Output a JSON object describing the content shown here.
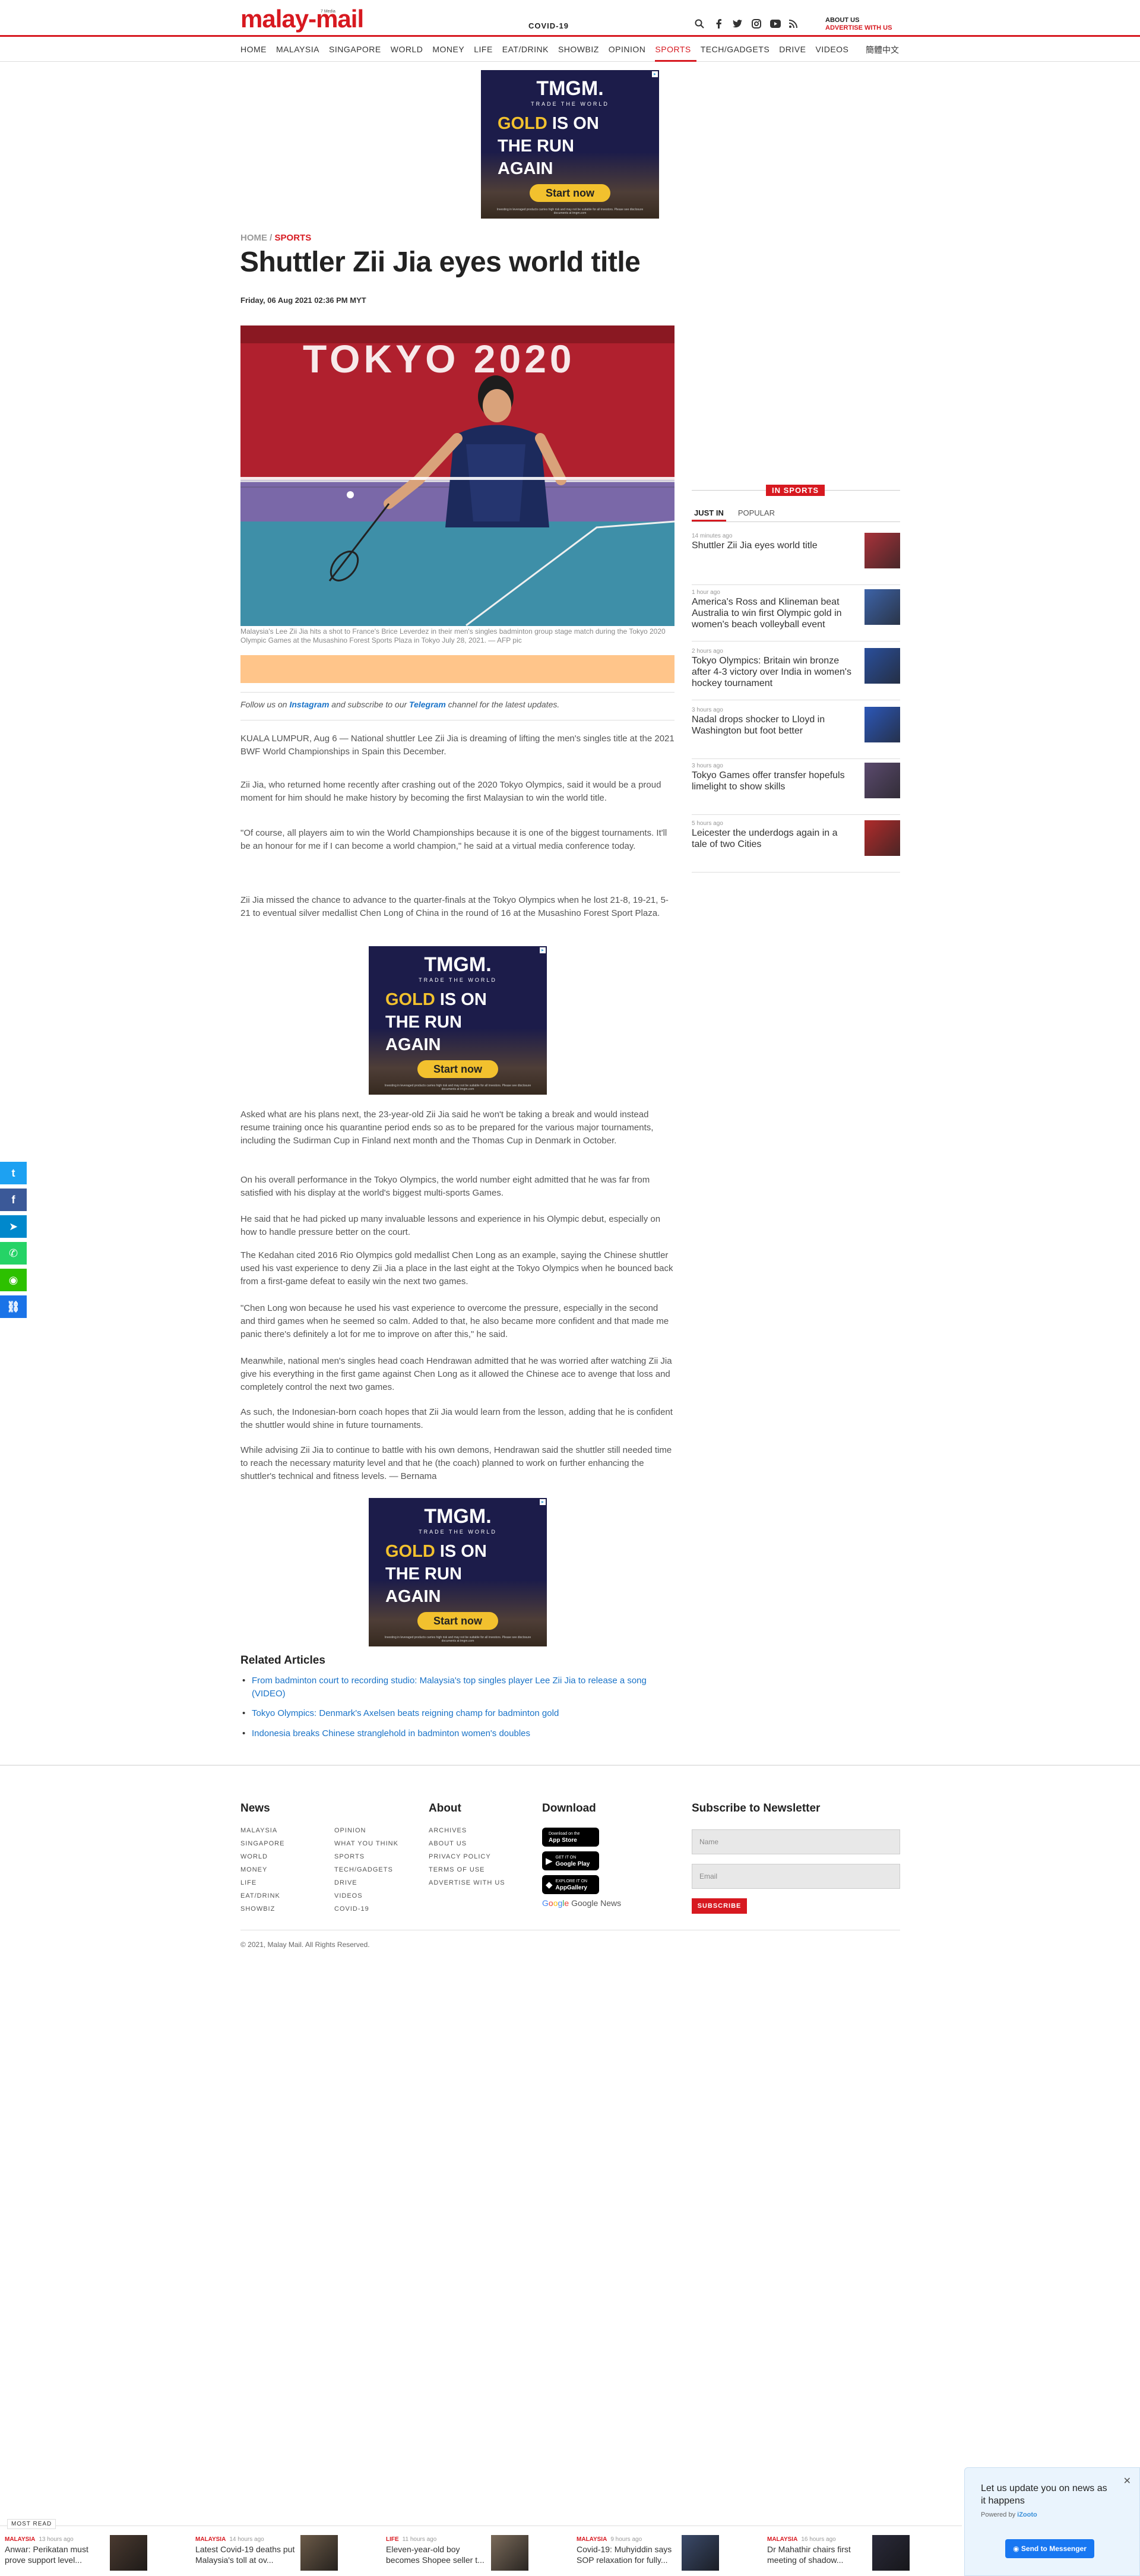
{
  "header": {
    "logo": "malay-mail",
    "logo_small": "7 Media",
    "covid": "COVID-19",
    "about": "ABOUT US",
    "advertise": "ADVERTISE WITH US",
    "icons": [
      "search-icon",
      "facebook-icon",
      "twitter-icon",
      "instagram-icon",
      "youtube-icon",
      "rss-icon"
    ]
  },
  "nav": {
    "items": [
      "HOME",
      "MALAYSIA",
      "SINGAPORE",
      "WORLD",
      "MONEY",
      "LIFE",
      "EAT/DRINK",
      "SHOWBIZ",
      "OPINION",
      "SPORTS",
      "TECH/GADGETS",
      "DRIVE",
      "VIDEOS"
    ],
    "active": "SPORTS",
    "chinese": "簡體中文"
  },
  "ad": {
    "brand": "TMGM.",
    "tagline": "TRADE THE WORLD",
    "line1_gold": "GOLD",
    "line1_rest": "IS ON",
    "line2": "THE RUN",
    "line3": "AGAIN",
    "cta": "Start now",
    "fine": "Investing in leveraged products carries high risk and may not be suitable for all investors. Please see disclosure documents at tmgm.com"
  },
  "article": {
    "breadcrumb_home": "HOME",
    "breadcrumb_sep": "/",
    "breadcrumb_section": "SPORTS",
    "title": "Shuttler Zii Jia eyes world title",
    "date": "Friday, 06 Aug 2021 02:36 PM MYT",
    "hero_text": "TOKYO 2020",
    "caption": "Malaysia's Lee Zii Jia hits a shot to France's Brice Leverdez in their men's singles badminton group stage match during the Tokyo 2020 Olympic Games at the Musashino Forest Sports Plaza in Tokyo July 28, 2021. — AFP pic",
    "follow_pre": "Follow us on ",
    "follow_instagram": "Instagram",
    "follow_mid": " and subscribe to our ",
    "follow_telegram": "Telegram",
    "follow_post": " channel for the latest updates.",
    "paragraphs": [
      "KUALA LUMPUR, Aug 6 — National shuttler Lee Zii Jia is dreaming of lifting the men's singles title at the 2021 BWF World Championships in Spain this December.",
      "Zii Jia, who returned home recently after crashing out of the 2020 Tokyo Olympics, said it would be a proud moment for him should he make history by becoming the first Malaysian to win the world title.",
      "\"Of course, all players aim to win the World Championships because it is one of the biggest tournaments. It'll be an honour for me if I can become a world champion,\" he said at a virtual media conference today.",
      "Zii Jia missed the chance to advance to the quarter-finals at the Tokyo Olympics when he lost 21-8, 19-21, 5-21 to eventual silver medallist Chen Long of China in the round of 16 at the Musashino Forest Sport Plaza.",
      "Asked what are his plans next, the 23-year-old Zii Jia said he won't be taking a break and would instead resume training once his quarantine period ends so as to be prepared for the various major tournaments, including the Sudirman Cup in Finland next month and the Thomas Cup in Denmark in October.",
      "On his overall performance in the Tokyo Olympics, the world number eight admitted that he was far from satisfied with his display at the world's biggest multi-sports Games.",
      "He said that he had picked up many invaluable lessons and experience in his Olympic debut, especially on how to handle pressure better on the court.",
      "The Kedahan cited 2016 Rio Olympics gold medallist Chen Long as an example, saying the Chinese shuttler used his vast experience to deny Zii Jia a place in the last eight at the Tokyo Olympics when he bounced back from a first-game defeat to easily win the next two games.",
      "\"Chen Long won because he used his vast experience to overcome the pressure, especially in the second and third games when he seemed so calm. Added to that, he also became more confident and that made me panic there's definitely a lot for me to improve on after this,\" he said.",
      "Meanwhile, national men's singles head coach Hendrawan admitted that he was worried after watching Zii Jia give his everything in the first game against Chen Long as it allowed the Chinese ace to avenge that loss and completely control the next two games.",
      "As such, the Indonesian-born coach hopes that Zii Jia would learn from the lesson, adding that he is confident the shuttler would shine in future tournaments.",
      "While advising Zii Jia to continue to battle with his own demons, Hendrawan said the shuttler still needed time to reach the necessary maturity level and that he (the coach) planned to work on further enhancing the shuttler's technical and fitness levels. — Bernama"
    ]
  },
  "sidebar": {
    "label": "IN SPORTS",
    "tabs": [
      "JUST IN",
      "POPULAR"
    ],
    "items": [
      {
        "time": "14 minutes ago",
        "title": "Shuttler Zii Jia eyes world title",
        "color": "#a8323a"
      },
      {
        "time": "1 hour ago",
        "title": "America's Ross and Klineman beat Australia to win first Olympic gold in women's beach volleyball event",
        "color": "#3d63a8"
      },
      {
        "time": "2 hours ago",
        "title": "Tokyo Olympics: Britain win bronze after 4-3 victory over India in women's hockey tournament",
        "color": "#2a4f9c"
      },
      {
        "time": "3 hours ago",
        "title": "Nadal drops shocker to Lloyd in Washington but foot better",
        "color": "#2c57b8"
      },
      {
        "time": "3 hours ago",
        "title": "Tokyo Games offer transfer hopefuls limelight to show skills",
        "color": "#5b4a6e"
      },
      {
        "time": "5 hours ago",
        "title": "Leicester the underdogs again in a tale of two Cities",
        "color": "#b02b2b"
      }
    ]
  },
  "related": {
    "heading": "Related Articles",
    "items": [
      "From badminton court to recording studio: Malaysia's top singles player Lee Zii Jia to release a song (VIDEO)",
      "Tokyo Olympics: Denmark's Axelsen beats reigning champ for badminton gold",
      "Indonesia breaks Chinese stranglehold in badminton women's doubles"
    ]
  },
  "footer": {
    "news_head": "News",
    "news_col1": [
      "MALAYSIA",
      "SINGAPORE",
      "WORLD",
      "MONEY",
      "LIFE",
      "EAT/DRINK",
      "SHOWBIZ"
    ],
    "news_col2": [
      "OPINION",
      "WHAT YOU THINK",
      "SPORTS",
      "TECH/GADGETS",
      "DRIVE",
      "VIDEOS",
      "COVID-19"
    ],
    "about_head": "About",
    "about_links": [
      "ARCHIVES",
      "ABOUT US",
      "PRIVACY POLICY",
      "TERMS OF USE",
      "ADVERTISE WITH US"
    ],
    "download_head": "Download",
    "stores": [
      {
        "small": "Download on the",
        "name": "App Store",
        "icon": ""
      },
      {
        "small": "GET IT ON",
        "name": "Google Play",
        "icon": "▶"
      },
      {
        "small": "EXPLORE IT ON",
        "name": "AppGallery",
        "icon": "◆"
      }
    ],
    "google_news": "Google News",
    "newsletter_head": "Subscribe to Newsletter",
    "name_placeholder": "Name",
    "email_placeholder": "Email",
    "subscribe": "SUBSCRIBE",
    "copyright": "© 2021, Malay Mail. All Rights Reserved."
  },
  "share": [
    {
      "name": "twitter-share",
      "color": "#1da1f2",
      "glyph": "t"
    },
    {
      "name": "facebook-share",
      "color": "#3b5998",
      "glyph": "f"
    },
    {
      "name": "telegram-share",
      "color": "#0088cc",
      "glyph": "➤"
    },
    {
      "name": "whatsapp-share",
      "color": "#25d366",
      "glyph": "✆"
    },
    {
      "name": "wechat-share",
      "color": "#2dc100",
      "glyph": "◉"
    },
    {
      "name": "link-share",
      "color": "#1a73e8",
      "glyph": "⛓"
    }
  ],
  "chat": {
    "text": "Let us update you on news as it happens",
    "powered_pre": "Powered by ",
    "powered_brand": "iZooto",
    "button": "Send to Messenger"
  },
  "most_read": {
    "label": "MOST READ",
    "items": [
      {
        "section": "MALAYSIA",
        "time": "13 hours ago",
        "title": "Anwar: Perikatan must prove support level...",
        "color": "#4a3a30"
      },
      {
        "section": "MALAYSIA",
        "time": "14 hours ago",
        "title": "Latest Covid-19 deaths put Malaysia's toll at ov...",
        "color": "#6b5a48"
      },
      {
        "section": "LIFE",
        "time": "11 hours ago",
        "title": "Eleven-year-old boy becomes Shopee seller t...",
        "color": "#7a6a5a"
      },
      {
        "section": "MALAYSIA",
        "time": "9 hours ago",
        "title": "Covid-19: Muhyiddin says SOP relaxation for fully...",
        "color": "#3b4a6a"
      },
      {
        "section": "MALAYSIA",
        "time": "16 hours ago",
        "title": "Dr Mahathir chairs first meeting of shadow...",
        "color": "#2a2a3a"
      }
    ]
  }
}
